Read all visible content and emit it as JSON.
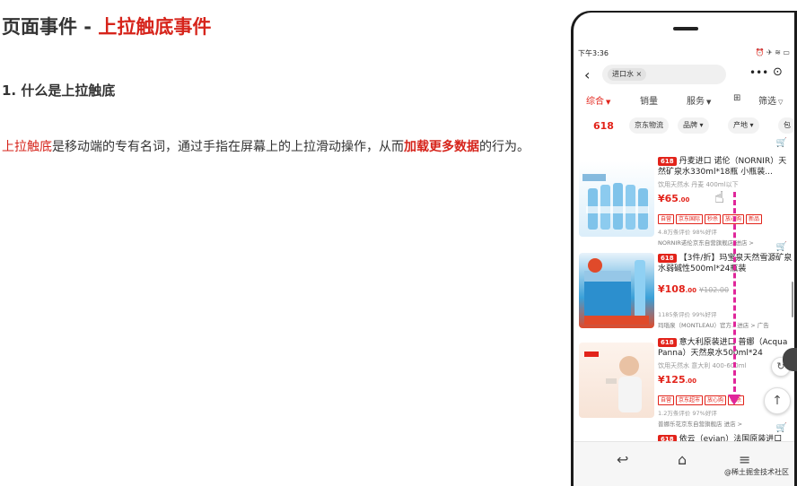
{
  "heading": {
    "prefix": "页面事件 - ",
    "accent": "上拉触底事件"
  },
  "subheading": "1. 什么是上拉触底",
  "paragraph": {
    "term": "上拉触底",
    "text1": "是移动端的专有名词，通过手指在屏幕上的上拉滑动操作，从而",
    "strong": "加载更多数据",
    "text2": "的行为。"
  },
  "phone": {
    "status_time": "下午3:36",
    "status_icons": "⏰ ✈ ≋ ▭",
    "search_chip": "进口水 ×",
    "more_icon": "•••",
    "target_icon": "⊙",
    "tabs": [
      {
        "label": "综合",
        "caret": "▼"
      },
      {
        "label": "销量",
        "caret": ""
      },
      {
        "label": "服务",
        "caret": "▼"
      },
      {
        "label": "⊞",
        "caret": ""
      },
      {
        "label": "筛选",
        "caret": "▽"
      }
    ],
    "filters": {
      "badge": "618",
      "buttons": [
        "京东物流",
        "品牌 ▾",
        "产地 ▾",
        "包"
      ]
    },
    "products": [
      {
        "tag": "618",
        "title": "丹麦进口 诺伦（NORNIR）天然矿泉水330ml*18瓶 小瓶装...",
        "sub": "饮用天然水   丹麦   400ml以下",
        "price": "¥65",
        "price_cents": ".00",
        "old_price": "",
        "tags": [
          "自营",
          "京东国际",
          "秒杀",
          "放心购",
          "新品"
        ],
        "meta": "4.8万条评价  98%好评",
        "store": "NORNIR诺伦京东自营旗舰店  进店 >"
      },
      {
        "tag": "618",
        "title": "【3件/折】玛宝泉天然雪源矿泉水弱碱性500ml*24瓶装",
        "sub": "",
        "price": "¥108",
        "price_cents": ".00",
        "old_price": "¥102.00",
        "tags": [],
        "meta": "1185条评价  99%好评",
        "store": "玛瑙泉（MONTLEAU）官方..  进店 >  广告"
      },
      {
        "tag": "618",
        "title": "意大利原装进口 普娜（Acqua Panna）天然泉水500ml*24",
        "sub": "饮用天然水   意大利   400-600ml",
        "price": "¥125",
        "price_cents": ".00",
        "old_price": "",
        "tags": [
          "自营",
          "京东超市",
          "放心购",
          "秒杀"
        ],
        "meta": "1.2万条评价  97%好评",
        "store": "普娜乐花京东自营旗舰店  进店 >"
      },
      {
        "tag": "618",
        "title": "依云（evian）法国原装进口",
        "sub": "",
        "price": "",
        "price_cents": "",
        "old_price": "",
        "tags": [],
        "meta": "",
        "store": ""
      }
    ],
    "cart_icon": "🛒",
    "nav": {
      "back": "↩",
      "home": "⌂",
      "menu": "≡"
    },
    "watermark": "@稀土掘金技术社区",
    "float_scroll_top": "↑",
    "float_other": "↻"
  },
  "colors": {
    "accent": "#d6241b",
    "jd_red": "#e2231a",
    "drag_line": "#e0269a"
  }
}
